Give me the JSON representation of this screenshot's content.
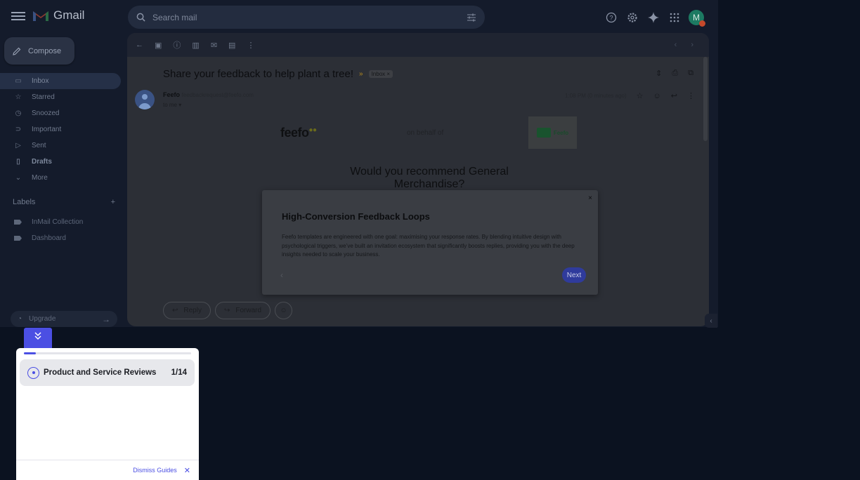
{
  "header": {
    "app_name": "Gmail",
    "search_placeholder": "Search mail",
    "avatar_letter": "M"
  },
  "sidebar": {
    "compose_label": "Compose",
    "items": [
      {
        "label": "Inbox",
        "icon": "inbox-icon",
        "active": true
      },
      {
        "label": "Starred",
        "icon": "star-icon"
      },
      {
        "label": "Snoozed",
        "icon": "clock-icon"
      },
      {
        "label": "Important",
        "icon": "important-icon"
      },
      {
        "label": "Sent",
        "icon": "send-icon"
      },
      {
        "label": "Drafts",
        "icon": "draft-icon",
        "bold": true
      },
      {
        "label": "More",
        "icon": "chevron-down-icon"
      }
    ],
    "labels_title": "Labels",
    "labels": [
      "InMail Collection",
      "Dashboard"
    ],
    "upgrade_label": "Upgrade"
  },
  "email": {
    "subject": "Share your feedback to help plant a tree!",
    "inbox_chip": "Inbox ×",
    "sender_name": "Feefo",
    "sender_email": "feedbackrequest@feefo.com",
    "to": "to me",
    "time": "1:08 PM (0 minutes ago)",
    "logo_text": "feefo",
    "on_behalf": "on behalf of",
    "brand_text": "Feefo",
    "question": "Would you recommend General Merchandise?",
    "reply_label": "Reply",
    "forward_label": "Forward"
  },
  "modal": {
    "title": "High-Conversion Feedback Loops",
    "body": "Feefo templates are engineered with one goal: maximising your response rates. By blending intuitive design with psychological triggers, we’ve built an invitation ecosystem that significantly boosts replies, providing you with the deep insights needed to scale your business.",
    "next_label": "Next",
    "close_label": "×",
    "prev_label": "‹"
  },
  "guides": {
    "item_name": "Product and Service Reviews",
    "item_count": "1/14",
    "progress": 0.07,
    "dismiss_label": "Dismiss Guides",
    "accent": "#4b4fe3"
  }
}
